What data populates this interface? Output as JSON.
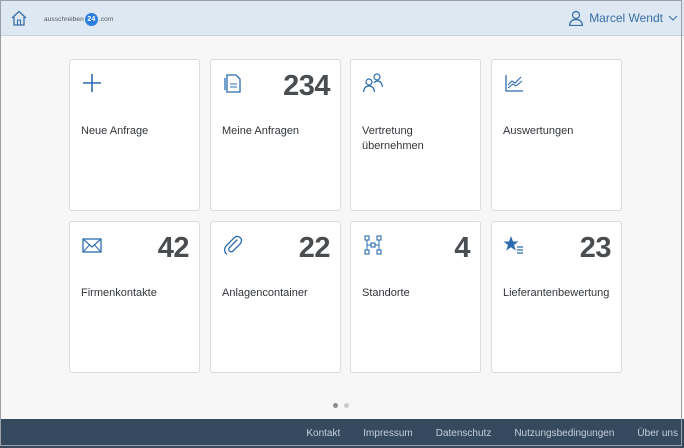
{
  "header": {
    "logo_prefix": "ausschreiben",
    "logo_badge": "24",
    "logo_suffix": ".com",
    "user_name": "Marcel Wendt"
  },
  "tiles": [
    {
      "name": "neue-anfrage",
      "icon": "plus-icon",
      "label": "Neue Anfrage",
      "count": ""
    },
    {
      "name": "meine-anfragen",
      "icon": "document-icon",
      "label": "Meine Anfragen",
      "count": "234"
    },
    {
      "name": "vertretung",
      "icon": "people-icon",
      "label": "Vertretung übernehmen",
      "count": ""
    },
    {
      "name": "auswertungen",
      "icon": "line-chart-icon",
      "label": "Auswertungen",
      "count": ""
    },
    {
      "name": "firmenkontakte",
      "icon": "envelope-icon",
      "label": "Firmenkontakte",
      "count": "42"
    },
    {
      "name": "anlagencontainer",
      "icon": "paperclip-icon",
      "label": "Anlagencontainer",
      "count": "22"
    },
    {
      "name": "standorte",
      "icon": "network-icon",
      "label": "Standorte",
      "count": "4"
    },
    {
      "name": "lieferantenbewertung",
      "icon": "star-list-icon",
      "label": "Lieferantenbewertung",
      "count": "23"
    }
  ],
  "footer": {
    "links": [
      "Kontakt",
      "Impressum",
      "Datenschutz",
      "Nutzungsbedingungen",
      "Über uns"
    ]
  },
  "colors": {
    "header_bg": "#dde8f3",
    "footer_bg": "#354a5f",
    "accent": "#2b6cb0"
  }
}
